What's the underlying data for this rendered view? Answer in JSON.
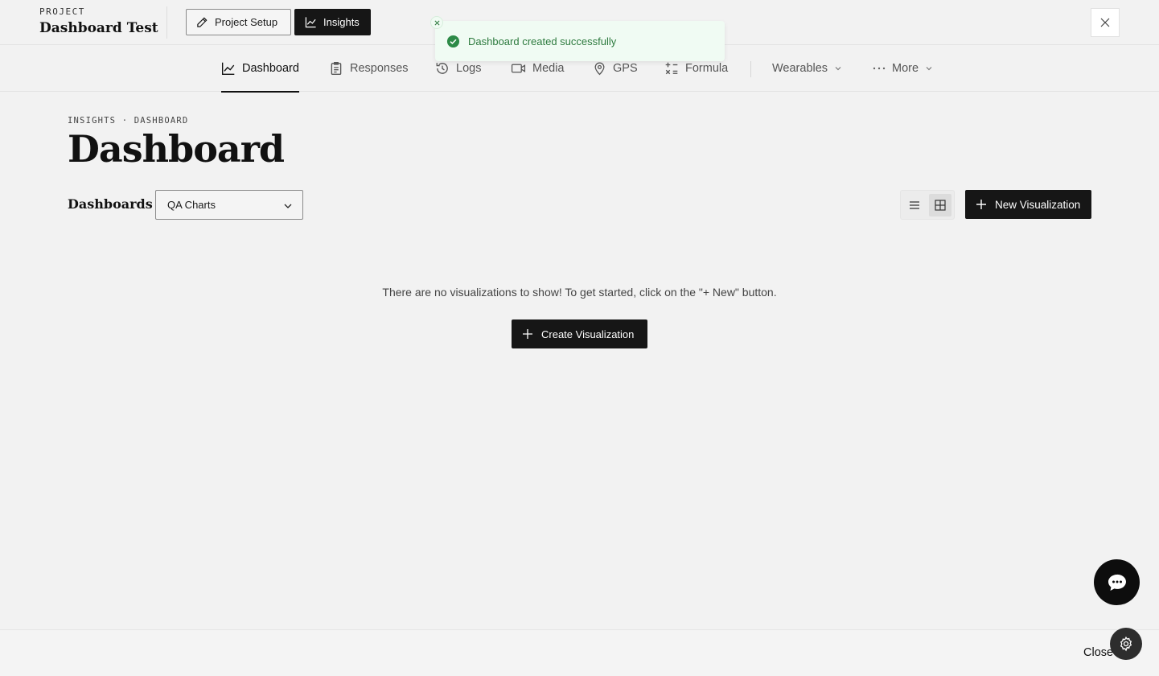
{
  "header": {
    "project_kicker": "PROJECT",
    "project_title": "Dashboard Test",
    "setup_button": "Project Setup",
    "insights_button": "Insights"
  },
  "toast": {
    "message": "Dashboard created successfully",
    "color": "#2d7a3e"
  },
  "nav": {
    "items": [
      {
        "label": "Dashboard",
        "icon": "line-chart-icon",
        "active": true
      },
      {
        "label": "Responses",
        "icon": "clipboard-icon"
      },
      {
        "label": "Logs",
        "icon": "history-icon"
      },
      {
        "label": "Media",
        "icon": "video-icon"
      },
      {
        "label": "GPS",
        "icon": "map-pin-icon"
      },
      {
        "label": "Formula",
        "icon": "calculator-icon"
      },
      {
        "label": "Wearables",
        "icon": "chevron-down-icon"
      },
      {
        "label": "More",
        "icon": "more-dots-icon"
      }
    ]
  },
  "main": {
    "breadcrumb": "INSIGHTS · DASHBOARD",
    "title": "Dashboard",
    "dashboards_label": "Dashboards",
    "selected_dashboard": "QA Charts",
    "new_visualization_button": "New Visualization",
    "empty_message": "There are no visualizations to show! To get started, click on the \"+ New\" button.",
    "create_visualization_button": "Create Visualization"
  },
  "footer": {
    "close_label": "Close"
  }
}
